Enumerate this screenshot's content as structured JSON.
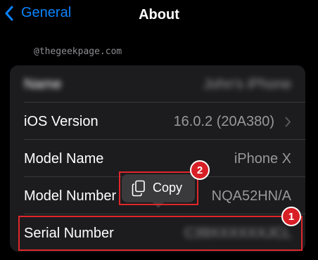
{
  "nav": {
    "back_label": "General",
    "title": "About"
  },
  "watermark": "@thegeekpage.com",
  "rows": [
    {
      "label": "Name",
      "value": "John's iPhone"
    },
    {
      "label": "iOS Version",
      "value": "16.0.2 (20A380)"
    },
    {
      "label": "Model Name",
      "value": "iPhone X"
    },
    {
      "label": "Model Number",
      "value": "NQA52HN/A"
    },
    {
      "label": "Serial Number",
      "value": "C39XXXXXXJCL"
    }
  ],
  "popup": {
    "copy_label": "Copy"
  },
  "annotations": {
    "badge1": "1",
    "badge2": "2",
    "color": "#e0262b"
  }
}
